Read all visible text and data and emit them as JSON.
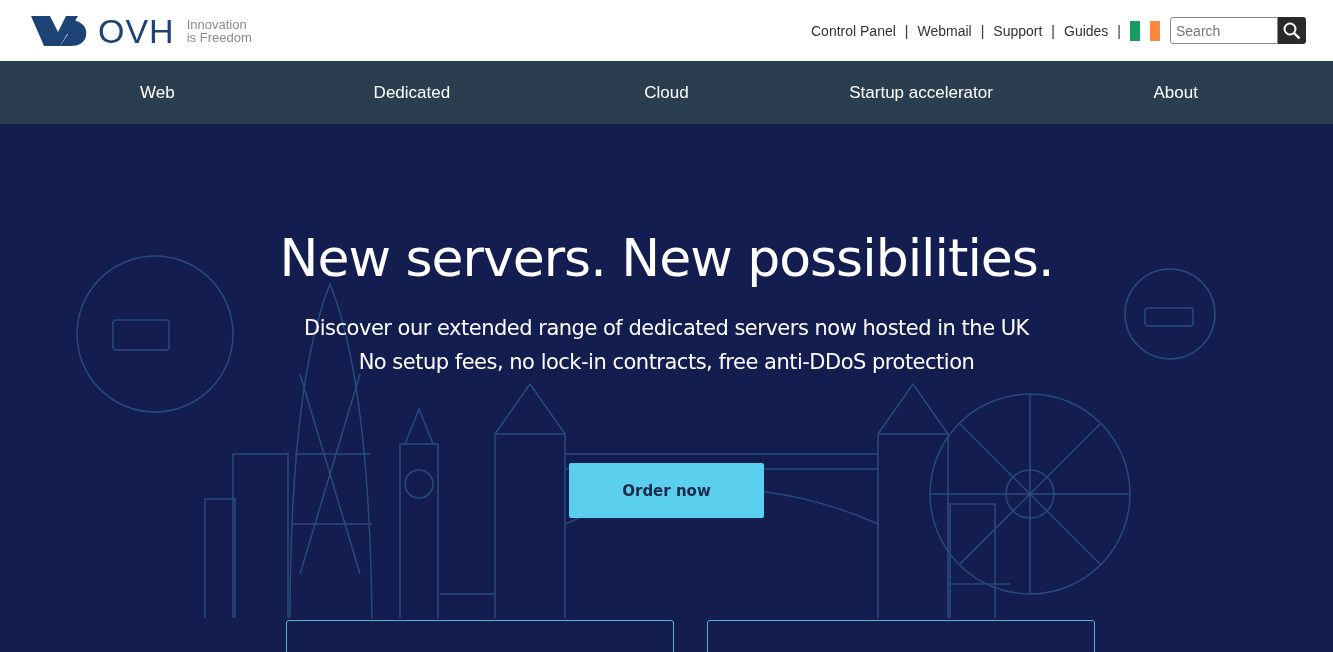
{
  "header": {
    "logo": {
      "wordmark": "OVH",
      "tagline_lines": [
        "Innovation",
        "is Freedom"
      ]
    },
    "top_links": [
      "Control Panel",
      "Webmail",
      "Support",
      "Guides"
    ],
    "separator": "|",
    "search": {
      "placeholder": "Search"
    }
  },
  "nav": {
    "items": [
      {
        "label": "Web"
      },
      {
        "label": "Dedicated"
      },
      {
        "label": "Cloud"
      },
      {
        "label": "Startup accelerator"
      },
      {
        "label": "About"
      }
    ]
  },
  "hero": {
    "title": "New servers. New possibilities.",
    "subtitle_lines": [
      "Discover our extended range of dedicated servers now hosted in the UK",
      "No setup fees, no lock-in contracts, free anti-DDoS protection"
    ],
    "button": "Order now",
    "cards": [
      {
        "kind": "outline"
      },
      {
        "kind": "outline"
      }
    ]
  }
}
